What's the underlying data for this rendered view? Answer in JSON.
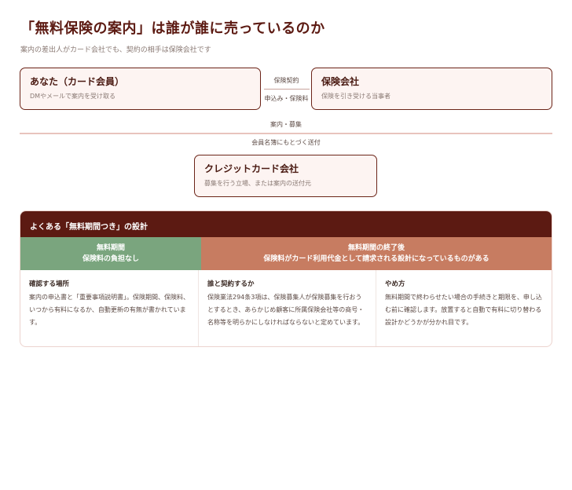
{
  "header": {
    "title": "「無料保険の案内」は誰が誰に売っているのか",
    "subtitle": "案内の差出人がカード会社でも、契約の相手は保険会社です"
  },
  "parties": {
    "you": {
      "title": "あなた（カード会員）",
      "desc": "DMやメールで案内を受け取る"
    },
    "insurer": {
      "title": "保険会社",
      "desc": "保険を引き受ける当事者"
    },
    "card_company": {
      "title": "クレジットカード会社",
      "desc": "募集を行う立場、または案内の送付元"
    }
  },
  "flows": {
    "contract": "保険契約",
    "application": "申込み・保険料",
    "guidance": "案内・募集",
    "mailing": "会員名簿にもとづく送付"
  },
  "design": {
    "header": "よくある「無料期間つき」の設計",
    "free_period": {
      "line1": "無料期間",
      "line2": "保険料の負担なし"
    },
    "after_period": {
      "line1": "無料期間の終了後",
      "line2": "保険料がカード利用代金として請求される設計になっているものがある"
    },
    "columns": [
      {
        "heading": "確認する場所",
        "body": "案内の申込書と「重要事項説明書」。保険期間、保険料、いつから有料になるか、自動更新の有無が書かれています。"
      },
      {
        "heading": "誰と契約するか",
        "body": "保険業法294条3項は、保険募集人が保険募集を行おうとするとき、あらかじめ顧客に所属保険会社等の商号・名称等を明らかにしなければならないと定めています。"
      },
      {
        "heading": "やめ方",
        "body": "無料期間で終わらせたい場合の手続きと期限を、申し込む前に確認します。放置すると自動で有料に切り替わる設計かどうかが分かれ目です。"
      }
    ]
  },
  "colors": {
    "accent": "#5c1a12",
    "free": "#7aa57e",
    "paid": "#c77c61",
    "box_bg": "#fdf4f2"
  }
}
